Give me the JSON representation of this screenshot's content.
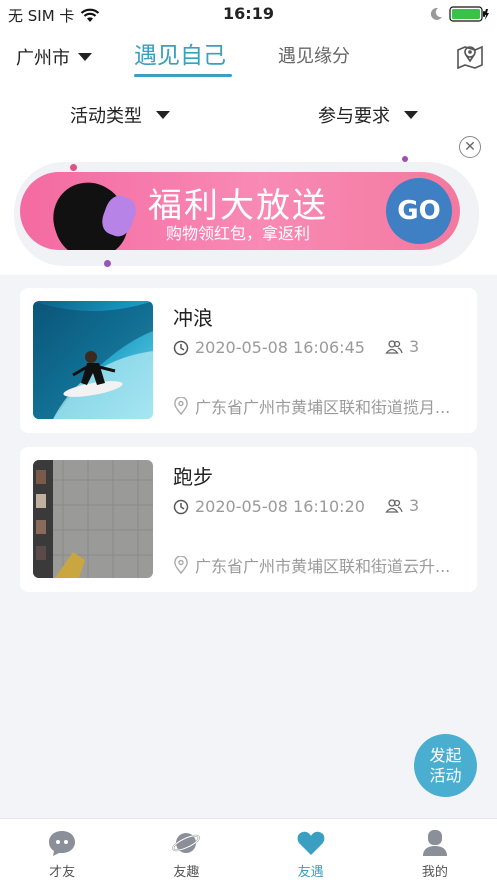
{
  "status_bar": {
    "carrier": "无 SIM 卡",
    "time": "16:19"
  },
  "header": {
    "city": "广州市",
    "tabs": [
      {
        "label": "遇见自己",
        "active": true
      },
      {
        "label": "遇见缘分",
        "active": false
      }
    ]
  },
  "filters": {
    "activity_type": "活动类型",
    "requirements": "参与要求"
  },
  "banner": {
    "title": "福利大放送",
    "subtitle": "购物领红包，拿返利",
    "go": "GO",
    "close": "✕"
  },
  "activities": [
    {
      "name": "冲浪",
      "time": "2020-05-08 16:06:45",
      "count": "3",
      "address": "广东省广州市黄埔区联和街道揽月..."
    },
    {
      "name": "跑步",
      "time": "2020-05-08 16:10:20",
      "count": "3",
      "address": "广东省广州市黄埔区联和街道云升..."
    }
  ],
  "fab": {
    "line1": "发起",
    "line2": "活动"
  },
  "tabbar": [
    {
      "label": "才友",
      "icon": "chat-bubble-icon"
    },
    {
      "label": "友趣",
      "icon": "planet-icon"
    },
    {
      "label": "友遇",
      "icon": "heart-icon",
      "active": true
    },
    {
      "label": "我的",
      "icon": "person-icon"
    }
  ],
  "colors": {
    "accent": "#3a9fc0",
    "fab": "#49aed0",
    "banner_pink": "#f46aa1",
    "go_button": "#3f7fc4"
  }
}
